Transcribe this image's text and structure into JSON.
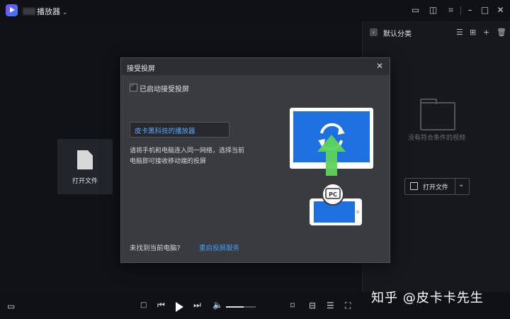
{
  "app": {
    "title": "播放器"
  },
  "main": {
    "open_file_label": "打开文件"
  },
  "right_panel": {
    "category_title": "默认分类",
    "empty_message": "没有符合条件的视频",
    "open_file_button": "打开文件"
  },
  "dialog": {
    "title": "接受投屏",
    "checkbox_label": "已启动接受投屏",
    "device_name": "皮卡黑科技的播放器",
    "description": "请将手机和电脑连入同一网络，选择当前电脑即可接收移动端的投屏",
    "footer_question": "未找到当前电脑?",
    "footer_link": "重启投屏服务",
    "pc_badge": "PC"
  },
  "player": {
    "volume_level": 0.6
  },
  "watermark": "知乎 @皮卡卡先生",
  "colors": {
    "accent": "#3e9dff",
    "screen_blue": "#1e6fe0",
    "arrow_green": "#5fd35a"
  }
}
